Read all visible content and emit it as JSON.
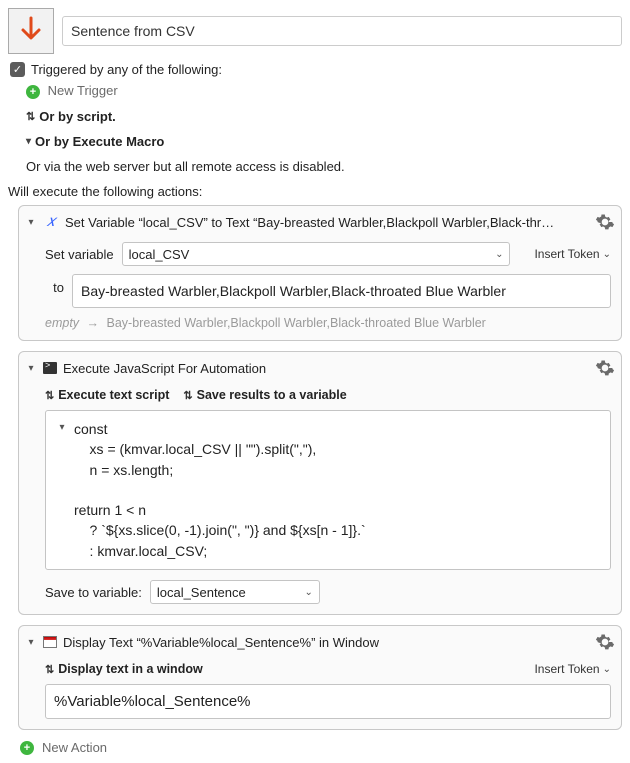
{
  "header": {
    "macro_name": "Sentence from CSV"
  },
  "triggers": {
    "any_label": "Triggered by any of the following:",
    "new_trigger": "New Trigger",
    "or_script": "Or by script.",
    "or_execute": "Or by Execute Macro",
    "or_web": "Or via the web server but all remote access is disabled."
  },
  "exec_label": "Will execute the following actions:",
  "action1": {
    "title": "Set Variable “local_CSV” to Text “Bay-breasted Warbler,Blackpoll Warbler,Black-thr…",
    "set_variable_label": "Set variable",
    "var_name": "local_CSV",
    "insert_token": "Insert Token",
    "to_label": "to",
    "text_value": "Bay-breasted Warbler,Blackpoll Warbler,Black-throated Blue Warbler",
    "preview_before": "empty",
    "preview_after": "Bay-breasted Warbler,Blackpoll Warbler,Black-throated Blue Warbler"
  },
  "action2": {
    "title": "Execute JavaScript For Automation",
    "opt_exec": "Execute text script",
    "opt_save": "Save results to a variable",
    "code": "const\n    xs = (kmvar.local_CSV || \"\").split(\",\"),\n    n = xs.length;\n\nreturn 1 < n\n    ? `${xs.slice(0, -1).join(\", \")} and ${xs[n - 1]}.`\n    : kmvar.local_CSV;",
    "save_label": "Save to variable:",
    "save_var": "local_Sentence"
  },
  "action3": {
    "title": "Display Text “%Variable%local_Sentence%” in Window",
    "opt_display": "Display text in a window",
    "insert_token": "Insert Token",
    "text_value": "%Variable%local_Sentence%"
  },
  "footer": {
    "new_action": "New Action"
  }
}
